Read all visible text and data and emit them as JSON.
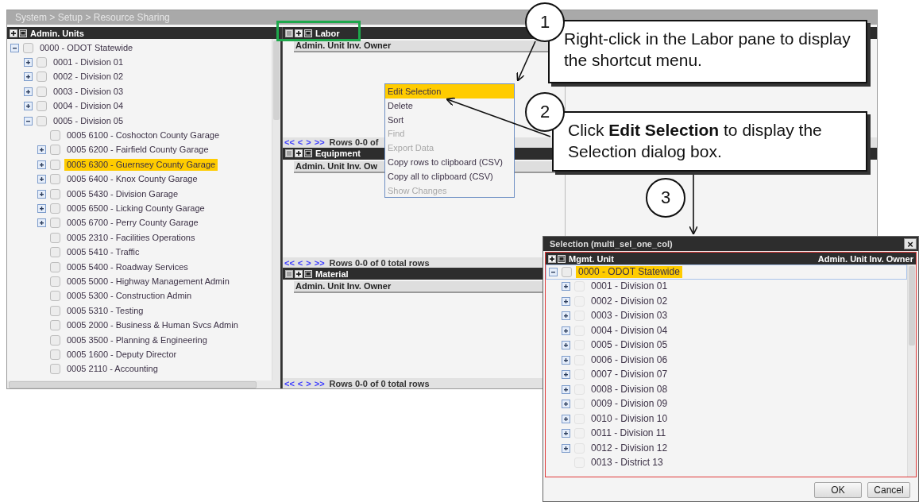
{
  "breadcrumb": "System > Setup > Resource Sharing",
  "left_pane": {
    "title": "Admin. Units",
    "tree": [
      {
        "label": "0000 - ODOT Statewide",
        "kind": "group",
        "expanded": true,
        "checked": false,
        "selected": false,
        "children": [
          {
            "label": "0001 - Division 01",
            "kind": "group",
            "expanded": false,
            "checked": false,
            "selected": false
          },
          {
            "label": "0002 - Division 02",
            "kind": "group",
            "expanded": false,
            "checked": false,
            "selected": false
          },
          {
            "label": "0003 - Division 03",
            "kind": "group",
            "expanded": false,
            "checked": false,
            "selected": false
          },
          {
            "label": "0004 - Division 04",
            "kind": "group",
            "expanded": false,
            "checked": false,
            "selected": false
          },
          {
            "label": "0005 - Division 05",
            "kind": "group",
            "expanded": true,
            "checked": false,
            "selected": false,
            "children": [
              {
                "label": "0005 6100 - Coshocton County Garage",
                "kind": "leaf",
                "checked": false,
                "selected": false
              },
              {
                "label": "0005 6200 - Fairfield County Garage",
                "kind": "group",
                "expanded": false,
                "checked": false,
                "selected": false
              },
              {
                "label": "0005 6300 - Guernsey County Garage",
                "kind": "group",
                "expanded": false,
                "checked": false,
                "selected": true
              },
              {
                "label": "0005 6400 - Knox County Garage",
                "kind": "group",
                "expanded": false,
                "checked": false,
                "selected": false
              },
              {
                "label": "0005 5430 - Division Garage",
                "kind": "group",
                "expanded": false,
                "checked": false,
                "selected": false
              },
              {
                "label": "0005 6500 - Licking County Garage",
                "kind": "group",
                "expanded": false,
                "checked": false,
                "selected": false
              },
              {
                "label": "0005 6700 - Perry County Garage",
                "kind": "group",
                "expanded": false,
                "checked": false,
                "selected": false
              },
              {
                "label": "0005 2310 - Facilities Operations",
                "kind": "leaf",
                "checked": false,
                "selected": false
              },
              {
                "label": "0005 5410 - Traffic",
                "kind": "leaf",
                "checked": false,
                "selected": false
              },
              {
                "label": "0005 5400 - Roadway Services",
                "kind": "leaf",
                "checked": false,
                "selected": false
              },
              {
                "label": "0005 5000 - Highway Management Admin",
                "kind": "leaf",
                "checked": false,
                "selected": false
              },
              {
                "label": "0005 5300 - Construction Admin",
                "kind": "leaf",
                "checked": false,
                "selected": false
              },
              {
                "label": "0005 5310 - Testing",
                "kind": "leaf",
                "checked": false,
                "selected": false
              },
              {
                "label": "0005 2000 - Business & Human Svcs Admin",
                "kind": "leaf",
                "checked": false,
                "selected": false
              },
              {
                "label": "0005 3500 - Planning & Engineering",
                "kind": "leaf",
                "checked": false,
                "selected": false
              },
              {
                "label": "0005 1600 - Deputy Director",
                "kind": "leaf",
                "checked": false,
                "selected": false
              },
              {
                "label": "0005 2110 - Accounting",
                "kind": "leaf",
                "checked": false,
                "selected": false
              }
            ]
          }
        ]
      }
    ]
  },
  "panes": [
    {
      "title": "Labor",
      "column": "Admin. Unit Inv. Owner",
      "nav": [
        "<<",
        "<",
        ">",
        ">>"
      ],
      "rows_text": "Rows 0-0 of"
    },
    {
      "title": "Equipment",
      "column": "Admin. Unit Inv. Ow",
      "nav": [
        "<<",
        "<",
        ">",
        ">>"
      ],
      "rows_text": "Rows 0-0 of 0 total rows"
    },
    {
      "title": "Material",
      "column": "Admin. Unit Inv. Owner",
      "nav": [
        "<<",
        "<",
        ">",
        ">>"
      ],
      "rows_text": "Rows 0-0 of 0 total rows"
    }
  ],
  "context_menu": [
    {
      "label": "Edit Selection",
      "selected": true,
      "disabled": false
    },
    {
      "label": "Delete",
      "selected": false,
      "disabled": false
    },
    {
      "label": "Sort",
      "selected": false,
      "disabled": false
    },
    {
      "label": "Find",
      "selected": false,
      "disabled": true
    },
    {
      "label": "Export Data",
      "selected": false,
      "disabled": true
    },
    {
      "label": "Copy rows to clipboard (CSV)",
      "selected": false,
      "disabled": false
    },
    {
      "label": "Copy all to clipboard (CSV)",
      "selected": false,
      "disabled": false
    },
    {
      "label": "Show Changes",
      "selected": false,
      "disabled": true
    }
  ],
  "callouts": [
    {
      "number": "1",
      "text": "Right-click in the Labor pane to display the shortcut menu."
    },
    {
      "number": "2",
      "text": "Click **Edit Selection** to display the Selection dialog box."
    },
    {
      "number": "3"
    }
  ],
  "dialog": {
    "title": "Selection (multi_sel_one_col)",
    "close": "×",
    "columns": [
      "Mgmt. Unit",
      "Admin. Unit Inv. Owner"
    ],
    "tree": [
      {
        "label": "0000 - ODOT Statewide",
        "kind": "group",
        "expanded": true,
        "checked": false,
        "disabled": false,
        "selected": true,
        "children": [
          {
            "label": "0001 - Division 01",
            "kind": "group",
            "expanded": false,
            "checked": false,
            "disabled": true,
            "selected": false
          },
          {
            "label": "0002 - Division 02",
            "kind": "group",
            "expanded": false,
            "checked": false,
            "disabled": true,
            "selected": false
          },
          {
            "label": "0003 - Division 03",
            "kind": "group",
            "expanded": false,
            "checked": false,
            "disabled": true,
            "selected": false
          },
          {
            "label": "0004 - Division 04",
            "kind": "group",
            "expanded": false,
            "checked": false,
            "disabled": true,
            "selected": false
          },
          {
            "label": "0005 - Division 05",
            "kind": "group",
            "expanded": false,
            "checked": false,
            "disabled": true,
            "selected": false
          },
          {
            "label": "0006 - Division 06",
            "kind": "group",
            "expanded": false,
            "checked": false,
            "disabled": true,
            "selected": false
          },
          {
            "label": "0007 - Division 07",
            "kind": "group",
            "expanded": false,
            "checked": false,
            "disabled": true,
            "selected": false
          },
          {
            "label": "0008 - Division 08",
            "kind": "group",
            "expanded": false,
            "checked": false,
            "disabled": true,
            "selected": false
          },
          {
            "label": "0009 - Division 09",
            "kind": "group",
            "expanded": false,
            "checked": false,
            "disabled": true,
            "selected": false
          },
          {
            "label": "0010 - Division 10",
            "kind": "group",
            "expanded": false,
            "checked": false,
            "disabled": true,
            "selected": false
          },
          {
            "label": "0011 - Division 11",
            "kind": "group",
            "expanded": false,
            "checked": false,
            "disabled": true,
            "selected": false
          },
          {
            "label": "0012 - Division 12",
            "kind": "group",
            "expanded": false,
            "checked": false,
            "disabled": true,
            "selected": false
          },
          {
            "label": "0013 - District 13",
            "kind": "leaf",
            "checked": false,
            "disabled": true,
            "selected": false
          }
        ]
      }
    ],
    "buttons": [
      "OK",
      "Cancel"
    ]
  }
}
